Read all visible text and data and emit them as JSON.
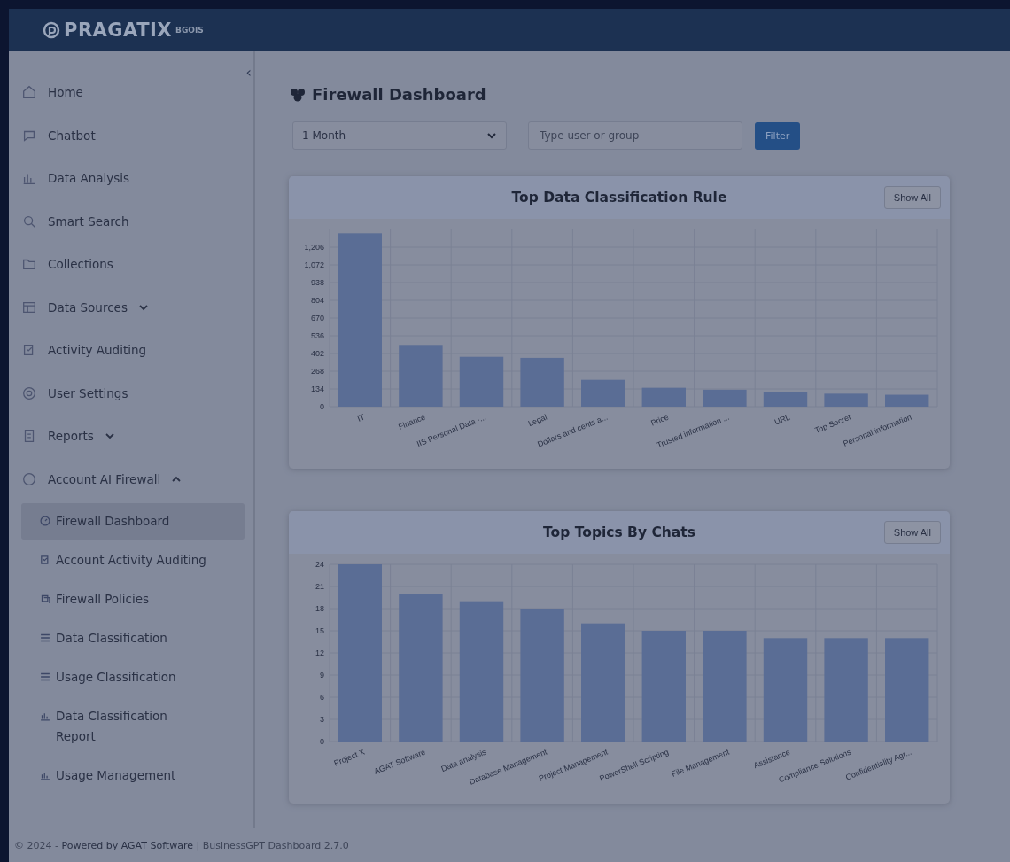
{
  "header": {
    "logo": "PRAGATIX",
    "logo_suffix": "BGOIS"
  },
  "sidebar": {
    "collapse": "‹",
    "items": [
      {
        "label": "Home",
        "selected": false
      },
      {
        "label": "Chatbot",
        "selected": false
      },
      {
        "label": "Data Analysis",
        "selected": false
      },
      {
        "label": "Smart Search",
        "selected": false
      },
      {
        "label": "Collections",
        "selected": false
      },
      {
        "label": "Data Sources",
        "selected": false,
        "expanded": false
      },
      {
        "label": "Activity Auditing",
        "selected": false
      },
      {
        "label": "User Settings",
        "selected": false
      },
      {
        "label": "Reports",
        "selected": false,
        "expanded": false
      },
      {
        "label": "Account AI Firewall",
        "selected": false,
        "expanded": true,
        "children": [
          {
            "label": "Firewall Dashboard",
            "selected": true
          },
          {
            "label": "Account Activity Auditing",
            "selected": false
          },
          {
            "label": "Firewall Policies",
            "selected": false
          },
          {
            "label": "Data Classification",
            "selected": false
          },
          {
            "label": "Usage Classification",
            "selected": false
          },
          {
            "label": "Data Classification Report",
            "selected": false
          },
          {
            "label": "Usage Management",
            "selected": false
          }
        ]
      }
    ]
  },
  "page": {
    "title": "Firewall Dashboard",
    "period": "1 Month",
    "search": {
      "placeholder": "Type user or group"
    },
    "filter_button": "Filter"
  },
  "cards": [
    {
      "title": "Top Data Classification Rule",
      "button": "Show All",
      "chart_data": {
        "type": "bar",
        "categories": [
          "IT",
          "Finance",
          "IIS Personal Data ·...",
          "Legal",
          "Dollars and cents a...",
          "Price",
          "Trusted information ...",
          "URL",
          "Top Secret",
          "Personal information"
        ],
        "values": [
          1311,
          467,
          377,
          369,
          203,
          143,
          128,
          113,
          98,
          90
        ],
        "ylim": [
          0,
          1340
        ],
        "grid": true,
        "yticks": [
          0,
          134,
          {
            "value": 268,
            "label": "268"
          },
          402,
          536,
          670,
          804,
          938,
          {
            "value": 1072,
            "label": "1,072"
          },
          {
            "value": 1206,
            "label": "1,206"
          }
        ]
      }
    },
    {
      "title": "Top Topics By Chats",
      "button": "Show All",
      "chart_data": {
        "type": "bar",
        "categories": [
          "Project X",
          "AGAT Software",
          "Data analysis",
          "Database Management",
          "Project Management",
          "PowerShell Scripting",
          "File Management",
          "Assistance",
          "Compliance Solutions",
          "Confidentiality Agr..."
        ],
        "values": [
          24,
          20,
          19,
          18,
          16,
          15,
          15,
          14,
          14,
          14
        ],
        "ylim": [
          0,
          24
        ],
        "grid": true,
        "yticks": [
          0,
          3,
          6,
          9,
          12,
          15,
          18,
          21,
          24
        ]
      }
    }
  ],
  "footer": {
    "copyright": "© 2024 - ",
    "link": "Powered by AGAT Software",
    "version": " | BusinessGPT Dashboard 2.7.0"
  }
}
